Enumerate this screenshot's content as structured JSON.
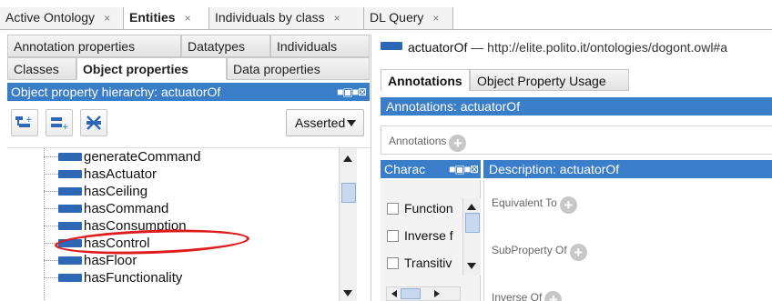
{
  "top_tabs": [
    {
      "label": "Active Ontology",
      "close": "×"
    },
    {
      "label": "Entities",
      "close": "×"
    },
    {
      "label": "Individuals by class",
      "close": "×"
    },
    {
      "label": "DL Query",
      "close": "×"
    }
  ],
  "left": {
    "subtabs_row1": [
      "Annotation properties",
      "Datatypes",
      "Individuals"
    ],
    "subtabs_row2": [
      "Classes",
      "Object properties",
      "Data properties"
    ],
    "hierarchy_header": "Object property hierarchy: actuatorOf",
    "view_controls": "■▣■⊠",
    "asserted": "Asserted",
    "tree_items": [
      "generateCommand",
      "hasActuator",
      "hasCeiling",
      "hasCommand",
      "hasConsumption",
      "hasControl",
      "hasFloor",
      "hasFunctionality"
    ],
    "highlighted_item": "hasConsumption"
  },
  "right": {
    "entity_name": "actuatorOf",
    "entity_iri": "— http://elite.polito.it/ontologies/dogont.owl#a",
    "tabs": [
      "Annotations",
      "Object Property Usage"
    ],
    "annotations_header": "Annotations: actuatorOf",
    "annotations_label": "Annotations",
    "characteristics_header": "Charac",
    "char_controls": "■▣■⊠",
    "description_header": "Description: actuatorOf",
    "characteristics": [
      "Function",
      "Inverse f",
      "Transitiv"
    ],
    "description_sections": [
      "Equivalent To",
      "SubProperty Of",
      "Inverse Of"
    ]
  },
  "colors": {
    "accent_header": "#3a7dc8",
    "property_bar": "#2d67b5",
    "highlight_circle": "#e01b1b"
  }
}
